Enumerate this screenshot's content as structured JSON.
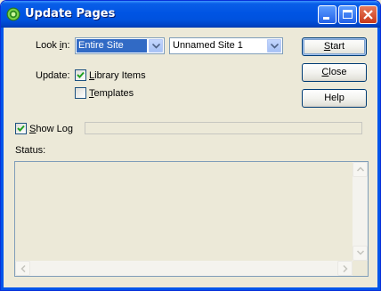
{
  "window": {
    "title": "Update Pages"
  },
  "look_in": {
    "label_pre": "Look ",
    "label_mnemonic": "i",
    "label_post": "n:",
    "scope_value": "Entire Site",
    "site_value": "Unnamed Site 1"
  },
  "update": {
    "label": "Update:",
    "library_items": {
      "mnemonic": "L",
      "rest": "ibrary Items",
      "checked": true
    },
    "templates": {
      "mnemonic": "T",
      "rest": "emplates",
      "checked": false
    }
  },
  "buttons": {
    "start": {
      "mnemonic": "S",
      "rest": "tart"
    },
    "close": {
      "mnemonic": "C",
      "rest": "lose"
    },
    "help": {
      "label": "Help"
    }
  },
  "log": {
    "mnemonic": "S",
    "rest": "how Log",
    "checked": true
  },
  "status": {
    "label": "Status:",
    "text": ""
  },
  "icons": {
    "app": "dreamweaver-icon",
    "minimize": "minimize-icon",
    "maximize": "maximize-icon",
    "close": "close-icon"
  },
  "colors": {
    "titlebar": "#0054e3",
    "selection": "#316ac5",
    "face": "#ece9d8"
  }
}
